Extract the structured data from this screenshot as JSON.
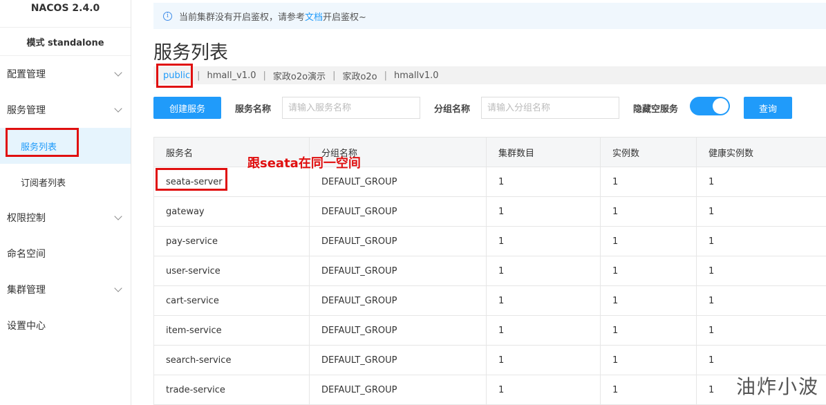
{
  "sidebar": {
    "brand": "NACOS 2.4.0",
    "mode": "模式 standalone",
    "items": [
      {
        "label": "配置管理"
      },
      {
        "label": "服务管理"
      },
      {
        "label": "服务列表"
      },
      {
        "label": "订阅者列表"
      },
      {
        "label": "权限控制"
      },
      {
        "label": "命名空间"
      },
      {
        "label": "集群管理"
      },
      {
        "label": "设置中心"
      }
    ]
  },
  "notice": {
    "prefix": "当前集群没有开启鉴权，请参考",
    "link": "文档",
    "suffix": "开启鉴权~"
  },
  "page_title": "服务列表",
  "namespaces": [
    "public",
    "hmall_v1.0",
    "家政o2o演示",
    "家政o2o",
    "hmallv1.0"
  ],
  "toolbar": {
    "create_button": "创建服务",
    "service_name_label": "服务名称",
    "service_name_placeholder": "请输入服务名称",
    "group_name_label": "分组名称",
    "group_name_placeholder": "请输入分组名称",
    "hide_empty_label": "隐藏空服务",
    "query_button": "查询"
  },
  "table": {
    "headers": [
      "服务名",
      "分组名称",
      "集群数目",
      "实例数",
      "健康实例数"
    ],
    "rows": [
      [
        "seata-server",
        "DEFAULT_GROUP",
        "1",
        "1",
        "1"
      ],
      [
        "gateway",
        "DEFAULT_GROUP",
        "1",
        "1",
        "1"
      ],
      [
        "pay-service",
        "DEFAULT_GROUP",
        "1",
        "1",
        "1"
      ],
      [
        "user-service",
        "DEFAULT_GROUP",
        "1",
        "1",
        "1"
      ],
      [
        "cart-service",
        "DEFAULT_GROUP",
        "1",
        "1",
        "1"
      ],
      [
        "item-service",
        "DEFAULT_GROUP",
        "1",
        "1",
        "1"
      ],
      [
        "search-service",
        "DEFAULT_GROUP",
        "1",
        "1",
        "1"
      ],
      [
        "trade-service",
        "DEFAULT_GROUP",
        "1",
        "1",
        "1"
      ]
    ]
  },
  "annotation": "跟seata在同一空间",
  "watermark": "油炸小波",
  "colors": {
    "accent": "#209bfa",
    "annotation": "#e00f0f"
  }
}
